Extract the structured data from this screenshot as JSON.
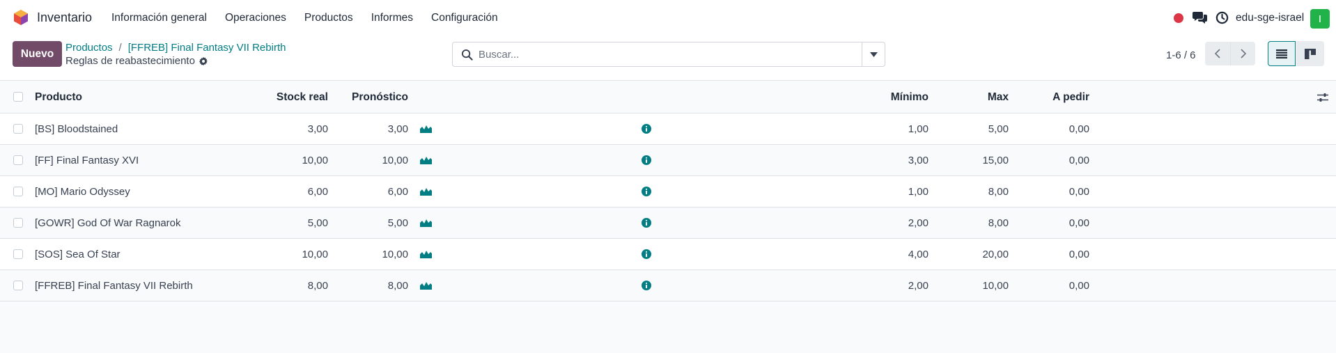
{
  "app": {
    "name": "Inventario",
    "menu": [
      "Información general",
      "Operaciones",
      "Productos",
      "Informes",
      "Configuración"
    ],
    "db_name": "edu-sge-israel",
    "avatar_letter": "I",
    "colors": {
      "brand": "#714b67",
      "accent": "#017e84",
      "avatar": "#21b34a",
      "record": "#dc3545"
    }
  },
  "control": {
    "new_label": "Nuevo",
    "breadcrumb": [
      "Productos",
      "[FFREB] Final Fantasy VII Rebirth"
    ],
    "breadcrumb_sep": "/",
    "subtitle": "Reglas de reabastecimiento",
    "search_placeholder": "Buscar...",
    "pager": "1-6 / 6"
  },
  "table": {
    "columns": {
      "product": "Producto",
      "stock": "Stock real",
      "forecast": "Pronóstico",
      "min": "Mínimo",
      "max": "Max",
      "order": "A pedir"
    },
    "rows": [
      {
        "product": "[BS] Bloodstained",
        "stock": "3,00",
        "forecast": "3,00",
        "min": "1,00",
        "max": "5,00",
        "order": "0,00"
      },
      {
        "product": "[FF] Final Fantasy XVI",
        "stock": "10,00",
        "forecast": "10,00",
        "min": "3,00",
        "max": "15,00",
        "order": "0,00"
      },
      {
        "product": "[MO] Mario Odyssey",
        "stock": "6,00",
        "forecast": "6,00",
        "min": "1,00",
        "max": "8,00",
        "order": "0,00"
      },
      {
        "product": "[GOWR] God Of War Ragnarok",
        "stock": "5,00",
        "forecast": "5,00",
        "min": "2,00",
        "max": "8,00",
        "order": "0,00"
      },
      {
        "product": "[SOS] Sea Of Star",
        "stock": "10,00",
        "forecast": "10,00",
        "min": "4,00",
        "max": "20,00",
        "order": "0,00"
      },
      {
        "product": "[FFREB] Final Fantasy VII Rebirth",
        "stock": "8,00",
        "forecast": "8,00",
        "min": "2,00",
        "max": "10,00",
        "order": "0,00"
      }
    ]
  }
}
